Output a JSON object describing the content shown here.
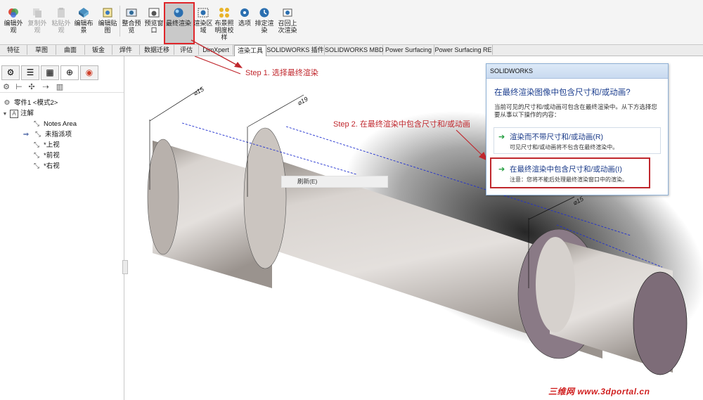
{
  "ribbon": {
    "buttons": [
      {
        "label": "编辑外观",
        "icon": "edit-appearance-icon",
        "enabled": true
      },
      {
        "label": "复制外观",
        "icon": "copy-appearance-icon",
        "enabled": false
      },
      {
        "label": "粘贴外观",
        "icon": "paste-appearance-icon",
        "enabled": false
      },
      {
        "label": "编辑布景",
        "icon": "edit-scene-icon",
        "enabled": true
      },
      {
        "label": "编辑贴图",
        "icon": "edit-decal-icon",
        "enabled": true
      },
      {
        "label": "整合预览",
        "icon": "integrated-preview-icon",
        "enabled": true
      },
      {
        "label": "预览窗口",
        "icon": "preview-window-icon",
        "enabled": true
      },
      {
        "label": "最终渲染",
        "icon": "final-render-icon",
        "enabled": true
      },
      {
        "label": "渲染区域",
        "icon": "render-region-icon",
        "enabled": true
      },
      {
        "label": "布景照明度校样",
        "icon": "scene-illumination-icon",
        "enabled": true
      },
      {
        "label": "选项",
        "icon": "options-icon",
        "enabled": true
      },
      {
        "label": "排定渲染",
        "icon": "schedule-render-icon",
        "enabled": true
      },
      {
        "label": "召回上次渲染",
        "icon": "recall-last-render-icon",
        "enabled": true
      }
    ]
  },
  "tabs": [
    "特征",
    "草图",
    "曲面",
    "钣金",
    "焊件",
    "数据迁移",
    "评估",
    "DimXpert",
    "渲染工具",
    "SOLIDWORKS 插件",
    "SOLIDWORKS MBD",
    "Power Surfacing",
    "Power Surfacing RE"
  ],
  "active_tab": "渲染工具",
  "tree": {
    "part": "零件1 <模式2>",
    "annotations": "注解",
    "items": [
      "Notes Area",
      "未指派项",
      "*上视",
      "*前视",
      "*右视"
    ]
  },
  "context_menu": {
    "item": "刷新(E)"
  },
  "steps": {
    "step1": "Step 1. 选择最终渲染",
    "step2": "Step 2. 在最终渲染中包含尺寸和/或动画"
  },
  "dialog": {
    "title": "SOLIDWORKS",
    "question": "在最终渲染图像中包含尺寸和/或动画?",
    "description": "当前可见的尺寸和/或动画可包含在最终渲染中。从下方选择您要从事以下操作的内容：",
    "options": [
      {
        "title": "渲染而不带尺寸和/或动画(R)",
        "note": "可见尺寸和/或动画将不包含在最终渲染中。"
      },
      {
        "title": "在最终渲染中包含尺寸和/或动画(I)",
        "note": "注意：您将不能后处理最终渲染窗口中的渲染。"
      }
    ]
  },
  "dimensions": [
    "⌀15",
    "⌀19",
    "⌀15"
  ],
  "watermark": "三维网 www.3dportal.cn",
  "colors": {
    "highlight": "#e0262a",
    "step_text": "#c0272d",
    "model_body": "#d8d3cf",
    "model_end": "#7d6c78",
    "dim_blue": "#1f2fcf"
  }
}
